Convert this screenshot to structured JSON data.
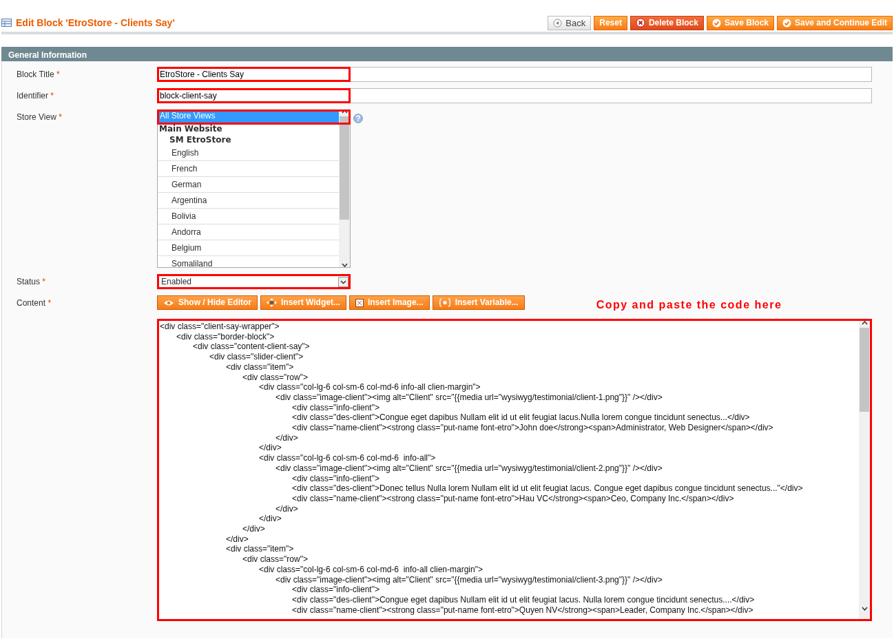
{
  "page": {
    "title": "Edit Block 'EtroStore - Clients Say'"
  },
  "header_buttons": [
    {
      "label": "Back",
      "kind": "back"
    },
    {
      "label": "Reset",
      "kind": "plain"
    },
    {
      "label": "Delete Block",
      "kind": "delete"
    },
    {
      "label": "Save Block",
      "kind": "save"
    },
    {
      "label": "Save and Continue Edit",
      "kind": "save"
    }
  ],
  "section": {
    "title": "General Information"
  },
  "fields": [
    {
      "kind": "text",
      "label": "Block Title",
      "required_mark": "*",
      "highlighted": true,
      "value": "EtroStore - Clients Say"
    },
    {
      "kind": "text",
      "label": "Identifier",
      "required_mark": "*",
      "highlighted": true,
      "value": "block-client-say"
    },
    {
      "kind": "multiselect",
      "label": "Store View",
      "required_mark": "*",
      "highlighted": true,
      "options": [
        {
          "kind": "option",
          "label": "All Store Views",
          "selected": true
        },
        {
          "kind": "group",
          "label": "Main Website",
          "children": [
            {
              "kind": "group",
              "label": "SM EtroStore",
              "children": [
                {
                  "kind": "option",
                  "label": "English",
                  "selected": false
                },
                {
                  "kind": "option",
                  "label": "French",
                  "selected": false
                },
                {
                  "kind": "option",
                  "label": "German",
                  "selected": false
                },
                {
                  "kind": "option",
                  "label": "Argentina",
                  "selected": false
                },
                {
                  "kind": "option",
                  "label": "Bolivia",
                  "selected": false
                },
                {
                  "kind": "option",
                  "label": "Andorra",
                  "selected": false
                },
                {
                  "kind": "option",
                  "label": "Belgium",
                  "selected": false
                },
                {
                  "kind": "option",
                  "label": "Somaliland",
                  "selected": false
                }
              ]
            }
          ]
        }
      ]
    },
    {
      "kind": "select",
      "label": "Status",
      "required_mark": "*",
      "highlighted": true,
      "value": "Enabled"
    },
    {
      "kind": "editor",
      "label": "Content",
      "required_mark": "*",
      "highlighted": true,
      "buttons": [
        {
          "label": "Show / Hide Editor",
          "kind": "eye"
        },
        {
          "label": "Insert Widget...",
          "kind": "widget"
        },
        {
          "label": "Insert Image...",
          "kind": "image"
        },
        {
          "label": "Insert Variable...",
          "kind": "variable"
        }
      ],
      "note": "Copy and paste the code here",
      "value": "<div class=\"client-say-wrapper\">\n\t<div class=\"border-block\">\n\t\t<div class=\"content-client-say\">\n\t\t\t<div class=\"slider-client\">\n\t\t\t\t<div class=\"item\">\n\t\t\t\t\t<div class=\"row\">\n\t\t\t\t\t\t<div class=\"col-lg-6 col-sm-6 col-md-6 info-all clien-margin\">\n\t\t\t\t\t\t\t<div class=\"image-client\"><img alt=\"Client\" src=\"{{media url=\"wysiwyg/testimonial/client-1.png\"}}\" /></div>\n\t\t\t\t\t\t\t\t<div class=\"info-client\">\n\t\t\t\t\t\t\t\t<div class=\"des-client\">Congue eget dapibus Nullam elit id ut elit feugiat lacus.Nulla lorem congue tincidunt senectus...</div>\n\t\t\t\t\t\t\t\t<div class=\"name-client\"><strong class=\"put-name font-etro\">John doe</strong><span>Administrator, Web Designer</span></div>\n\t\t\t\t\t\t\t</div>\n\t\t\t\t\t\t</div>\n\t\t\t\t\t\t<div class=\"col-lg-6 col-sm-6 col-md-6  info-all\">\n\t\t\t\t\t\t\t<div class=\"image-client\"><img alt=\"Client\" src=\"{{media url=\"wysiwyg/testimonial/client-2.png\"}}\" /></div>\n\t\t\t\t\t\t\t\t<div class=\"info-client\">\n\t\t\t\t\t\t\t\t<div class=\"des-client\">Donec tellus Nulla lorem Nullam elit id ut elit feugiat lacus. Congue eget dapibus congue tincidunt senectus...\"</div>\n\t\t\t\t\t\t\t\t<div class=\"name-client\"><strong class=\"put-name font-etro\">Hau VC</strong><span>Ceo, Company Inc.</span></div>\n\t\t\t\t\t\t\t</div>\n\t\t\t\t\t\t</div>\n\t\t\t\t\t</div>\n\t\t\t\t</div>\n\t\t\t\t<div class=\"item\">\n\t\t\t\t\t<div class=\"row\">\n\t\t\t\t\t\t<div class=\"col-lg-6 col-sm-6 col-md-6  info-all clien-margin\">\n\t\t\t\t\t\t\t<div class=\"image-client\"><img alt=\"Client\" src=\"{{media url=\"wysiwyg/testimonial/client-3.png\"}}\" /></div>\n\t\t\t\t\t\t\t\t<div class=\"info-client\">\n\t\t\t\t\t\t\t\t<div class=\"des-client\">Congue eget dapibus Nullam elit id ut elit feugiat lacus. Nulla lorem congue tincidunt senectus....</div>\n\t\t\t\t\t\t\t\t<div class=\"name-client\"><strong class=\"put-name font-etro\">Quyen NV</strong><span>Leader, Company Inc.</span></div>"
    }
  ]
}
